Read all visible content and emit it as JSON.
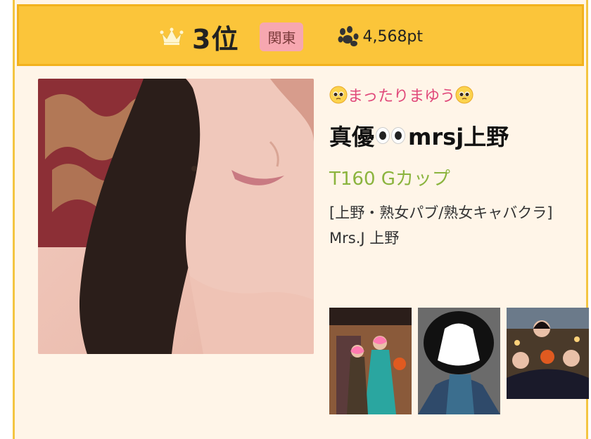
{
  "header": {
    "rank": "3位",
    "region": "関東",
    "points": "4,568pt",
    "crown_icon": "crown-icon",
    "paw_icon": "paw-icon",
    "colors": {
      "bar": "#fbc53a",
      "badge": "#f7a7b0"
    }
  },
  "profile": {
    "catchphrase": "まったりまゆう",
    "name_prefix": "真優",
    "name_suffix": "mrsj上野",
    "size": "T160 Gカップ",
    "category": "[上野・熟女パブ/熟女キャバクラ]",
    "shop": "Mrs.J 上野",
    "colors": {
      "catch": "#e0487a",
      "size": "#8bb43e"
    }
  },
  "thumbnails": [
    {
      "icon": "photo-thumbnail"
    },
    {
      "icon": "photo-thumbnail"
    },
    {
      "icon": "photo-thumbnail"
    }
  ]
}
